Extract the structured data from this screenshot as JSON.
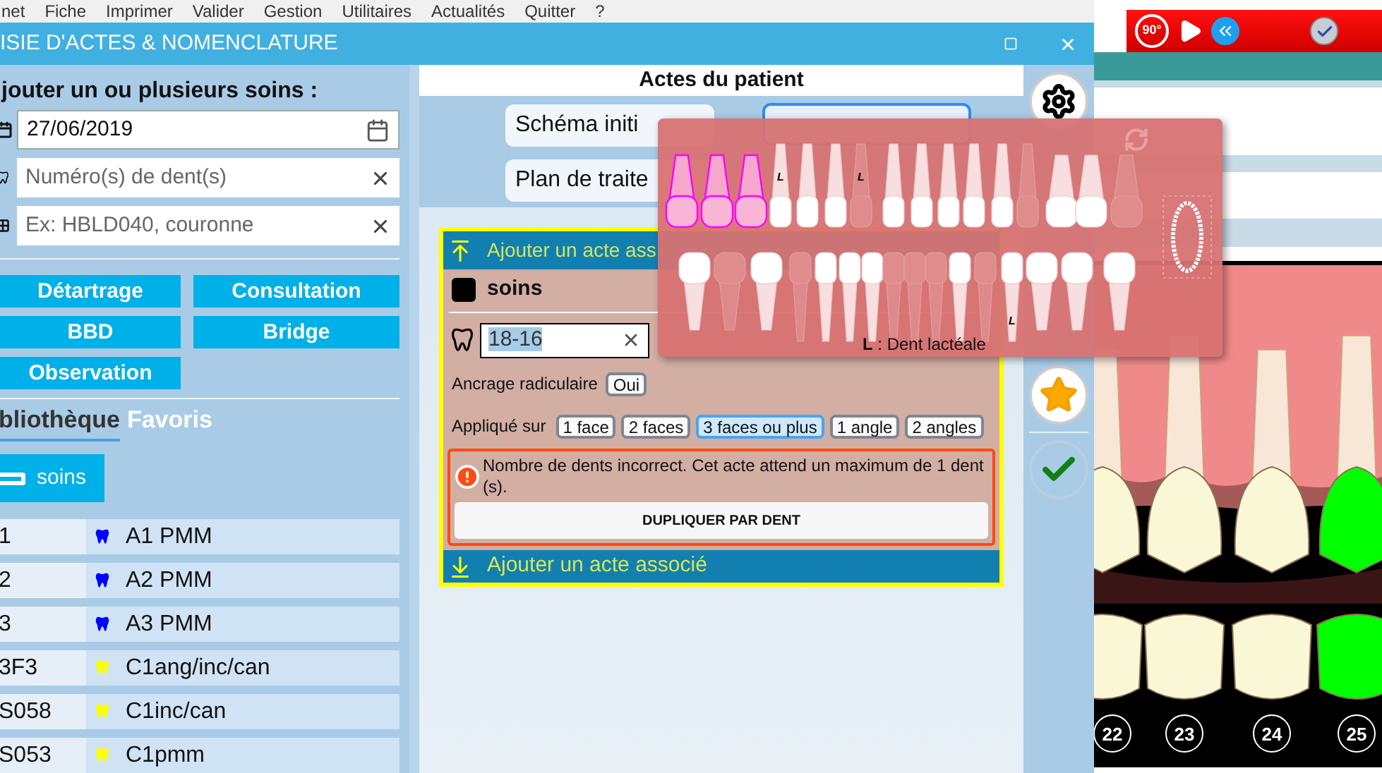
{
  "menu": [
    "net",
    "Fiche",
    "Imprimer",
    "Valider",
    "Gestion",
    "Utilitaires",
    "Actualités",
    "Quitter",
    "?"
  ],
  "window": {
    "title": "ISIE D'ACTES & NOMENCLATURE"
  },
  "toolbar": {
    "rotate_label": "90°"
  },
  "left_panel": {
    "heading": "jouter un ou plusieurs soins :",
    "date_field": {
      "value": "27/06/2019"
    },
    "tooth_field": {
      "placeholder": "Numéro(s) de dent(s)"
    },
    "code_field": {
      "placeholder": "Ex: HBLD040, couronne"
    },
    "quick_buttons": [
      "Détartrage",
      "Consultation",
      "BBD",
      "Bridge",
      "Observation"
    ],
    "tabs": [
      {
        "label": "bliothèque",
        "selected": true
      },
      {
        "label": "Favoris",
        "selected": false
      }
    ],
    "folder": {
      "label": "soins"
    },
    "acts": [
      {
        "code": "1",
        "color": "#0000ff",
        "label": "A1 PMM"
      },
      {
        "code": "2",
        "color": "#0000ff",
        "label": "A2 PMM"
      },
      {
        "code": "3",
        "color": "#0000ff",
        "label": "A3 PMM"
      },
      {
        "code": "3F3",
        "color": "#ffff00",
        "label": "C1ang/inc/can"
      },
      {
        "code": "S058",
        "color": "#ffff00",
        "label": "C1inc/can"
      },
      {
        "code": "S053",
        "color": "#ffff00",
        "label": "C1pmm"
      }
    ]
  },
  "patient_acts": {
    "heading": "Actes du patient",
    "buttons": [
      {
        "label": "Schéma initi"
      },
      {
        "label": "Plan de traite"
      }
    ]
  },
  "act_card": {
    "top_link": "Ajouter un acte ass",
    "group": "soins",
    "teeth_value": "18-16",
    "anchor": {
      "label": "Ancrage radiculaire",
      "options": [
        {
          "label": "Oui",
          "selected": false
        }
      ]
    },
    "applied": {
      "label": "Appliqué sur",
      "options": [
        {
          "label": "1 face",
          "selected": false
        },
        {
          "label": "2 faces",
          "selected": false
        },
        {
          "label": "3 faces ou plus",
          "selected": true
        },
        {
          "label": "1 angle",
          "selected": false
        },
        {
          "label": "2 angles",
          "selected": false
        }
      ]
    },
    "error": {
      "message": "Nombre de dents incorrect. Cet acte attend un maximum de 1 dent (s).",
      "button": "DUPLIQUER PAR DENT"
    },
    "bottom_link": "Ajouter un acte associé"
  },
  "tooth_picker": {
    "upper": [
      {
        "selected": true,
        "absent": false
      },
      {
        "selected": true,
        "absent": false
      },
      {
        "selected": true,
        "absent": false
      },
      {
        "selected": false,
        "absent": false,
        "mark": "L"
      },
      {
        "selected": false,
        "absent": false
      },
      {
        "selected": false,
        "absent": false
      },
      {
        "selected": false,
        "absent": true,
        "mark": "L"
      },
      {
        "selected": false,
        "absent": false
      },
      {
        "selected": false,
        "absent": false
      },
      {
        "selected": false,
        "absent": false
      },
      {
        "selected": false,
        "absent": false
      },
      {
        "selected": false,
        "absent": false
      },
      {
        "selected": false,
        "absent": true
      },
      {
        "selected": false,
        "absent": false
      },
      {
        "selected": false,
        "absent": false
      },
      {
        "selected": false,
        "absent": true
      }
    ],
    "lower": [
      {
        "selected": false,
        "absent": false
      },
      {
        "selected": false,
        "absent": true
      },
      {
        "selected": false,
        "absent": false
      },
      {
        "selected": false,
        "absent": true
      },
      {
        "selected": false,
        "absent": false
      },
      {
        "selected": false,
        "absent": false
      },
      {
        "selected": false,
        "absent": false
      },
      {
        "selected": false,
        "absent": true
      },
      {
        "selected": false,
        "absent": true
      },
      {
        "selected": false,
        "absent": true
      },
      {
        "selected": false,
        "absent": false
      },
      {
        "selected": false,
        "absent": true
      },
      {
        "selected": false,
        "absent": false,
        "mark": "L"
      },
      {
        "selected": false,
        "absent": false
      },
      {
        "selected": false,
        "absent": false
      },
      {
        "selected": false,
        "absent": false
      }
    ],
    "legend": "**L** : Dent lactéale"
  },
  "chart": {
    "teeth": [
      {
        "number": "22",
        "color": "#faf7d7"
      },
      {
        "number": "23",
        "color": "#faf7d7"
      },
      {
        "number": "24",
        "color": "#faf7d7"
      },
      {
        "number": "25",
        "color": "#00ff00"
      }
    ]
  }
}
